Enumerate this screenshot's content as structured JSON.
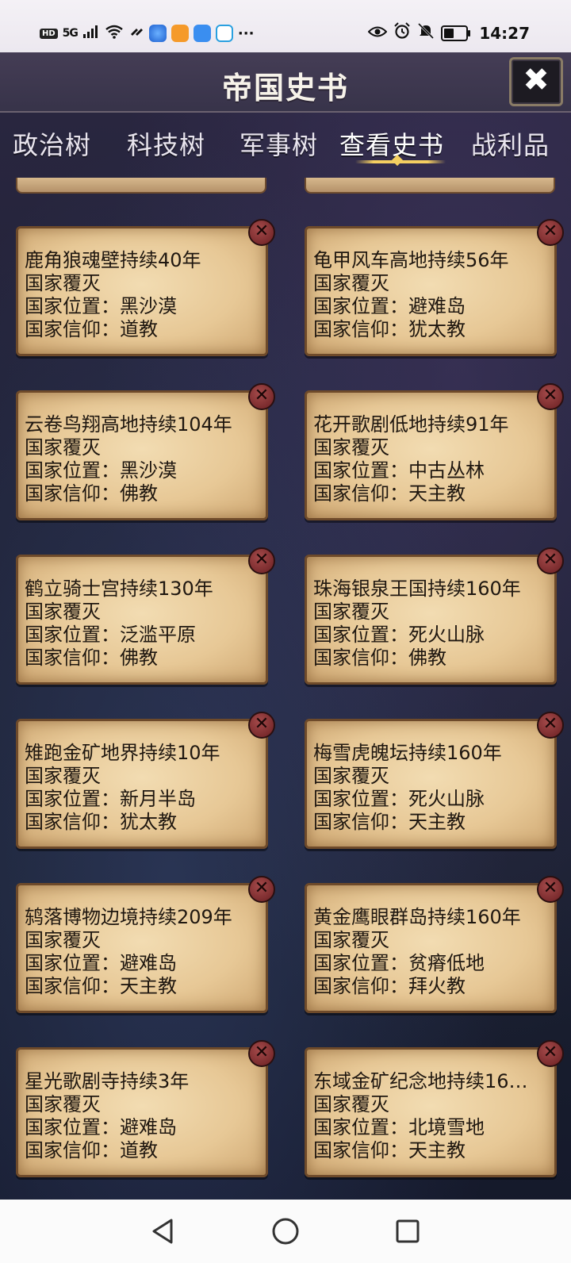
{
  "status_bar": {
    "hd": "HD",
    "network": "5G",
    "dots": "···",
    "time": "14:27",
    "battery_level": 0.45
  },
  "header": {
    "title": "帝国史书",
    "close_icon": "close-icon"
  },
  "tabs": [
    {
      "label": "政治树",
      "active": false
    },
    {
      "label": "科技树",
      "active": false
    },
    {
      "label": "军事树",
      "active": false
    },
    {
      "label": "查看史书",
      "active": true
    },
    {
      "label": "战利品",
      "active": false
    }
  ],
  "cards": [
    {
      "title": "鹿角狼魂壁持续40年",
      "status": "国家覆灭",
      "location": "国家位置：黑沙漠",
      "belief": "国家信仰：道教"
    },
    {
      "title": "龟甲风车高地持续56年",
      "status": "国家覆灭",
      "location": "国家位置：避难岛",
      "belief": "国家信仰：犹太教"
    },
    {
      "title": "云卷鸟翔高地持续104年",
      "status": "国家覆灭",
      "location": "国家位置：黑沙漠",
      "belief": "国家信仰：佛教"
    },
    {
      "title": "花开歌剧低地持续91年",
      "status": "国家覆灭",
      "location": "国家位置：中古丛林",
      "belief": "国家信仰：天主教"
    },
    {
      "title": "鹤立骑士宫持续130年",
      "status": "国家覆灭",
      "location": "国家位置：泛滥平原",
      "belief": "国家信仰：佛教"
    },
    {
      "title": "珠海银泉王国持续160年",
      "status": "国家覆灭",
      "location": "国家位置：死火山脉",
      "belief": "国家信仰：佛教"
    },
    {
      "title": "雉跑金矿地界持续10年",
      "status": "国家覆灭",
      "location": "国家位置：新月半岛",
      "belief": "国家信仰：犹太教"
    },
    {
      "title": "梅雪虎魄坛持续160年",
      "status": "国家覆灭",
      "location": "国家位置：死火山脉",
      "belief": "国家信仰：天主教"
    },
    {
      "title": "鸫落博物边境持续209年",
      "status": "国家覆灭",
      "location": "国家位置：避难岛",
      "belief": "国家信仰：天主教"
    },
    {
      "title": "黄金鹰眼群岛持续160年",
      "status": "国家覆灭",
      "location": "国家位置：贫瘠低地",
      "belief": "国家信仰：拜火教"
    },
    {
      "title": "星光歌剧寺持续3年",
      "status": "国家覆灭",
      "location": "国家位置：避难岛",
      "belief": "国家信仰：道教"
    },
    {
      "title": "东域金矿纪念地持续16…",
      "status": "国家覆灭",
      "location": "国家位置：北境雪地",
      "belief": "国家信仰：天主教"
    }
  ],
  "nav": {
    "back_icon": "back-icon",
    "home_icon": "home-icon",
    "recent_icon": "recent-apps-icon"
  },
  "colors": {
    "parchment": "#e7c896",
    "border": "#6e4a2a",
    "accent_gold": "#f4cf61",
    "delete_red": "#8a2f32"
  }
}
